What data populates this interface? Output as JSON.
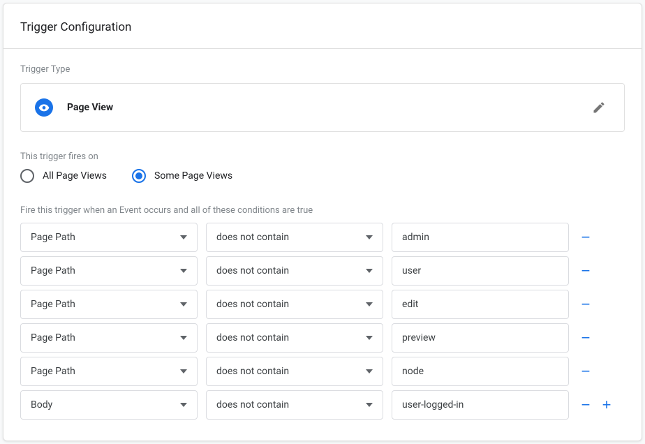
{
  "header": {
    "title": "Trigger Configuration"
  },
  "triggerType": {
    "label": "Trigger Type",
    "name": "Page View"
  },
  "firesOn": {
    "label": "This trigger fires on",
    "options": {
      "all": {
        "label": "All Page Views",
        "selected": false
      },
      "some": {
        "label": "Some Page Views",
        "selected": true
      }
    }
  },
  "conditions": {
    "label": "Fire this trigger when an Event occurs and all of these conditions are true",
    "rows": [
      {
        "variable": "Page Path",
        "operator": "does not contain",
        "value": "admin"
      },
      {
        "variable": "Page Path",
        "operator": "does not contain",
        "value": "user"
      },
      {
        "variable": "Page Path",
        "operator": "does not contain",
        "value": "edit"
      },
      {
        "variable": "Page Path",
        "operator": "does not contain",
        "value": "preview"
      },
      {
        "variable": "Page Path",
        "operator": "does not contain",
        "value": "node"
      },
      {
        "variable": "Body",
        "operator": "does not contain",
        "value": "user-logged-in"
      }
    ]
  }
}
